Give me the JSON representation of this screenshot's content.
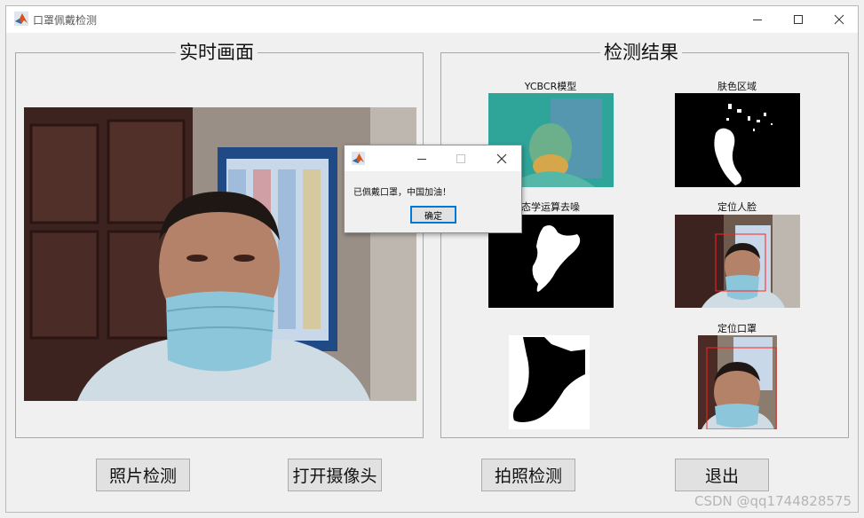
{
  "window": {
    "title": "口罩佩戴检测"
  },
  "live_panel": {
    "title": "实时画面"
  },
  "results_panel": {
    "title": "检测结果",
    "axes": [
      {
        "label": "YCBCR模型"
      },
      {
        "label": "肤色区域"
      },
      {
        "label": "态学运算去噪"
      },
      {
        "label": "定位人脸"
      },
      {
        "label": ""
      },
      {
        "label": "定位口罩"
      }
    ]
  },
  "buttons": {
    "photo_detect": "照片检测",
    "open_camera": "打开摄像头",
    "capture_detect": "拍照检测",
    "exit": "退出"
  },
  "dialog": {
    "message": "已佩戴口罩，中国加油！",
    "ok_label": "确定"
  },
  "watermark": "CSDN @qq1744828575",
  "colors": {
    "titlebar": "#ffffff",
    "background": "#f0f0f0",
    "detection_box": "#ff2020",
    "ok_button_border": "#0078d7"
  }
}
